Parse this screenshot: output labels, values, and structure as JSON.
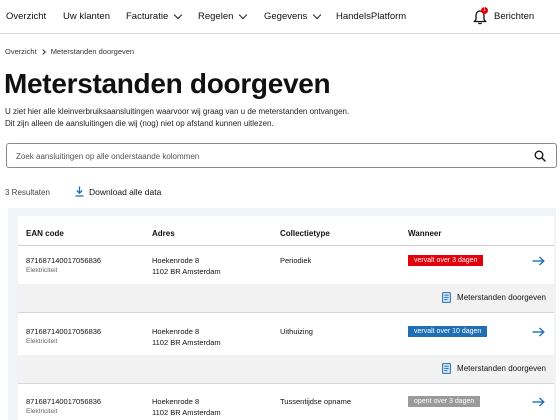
{
  "nav": {
    "items": [
      {
        "label": "Overzicht",
        "dropdown": false
      },
      {
        "label": "Uw klanten",
        "dropdown": false
      },
      {
        "label": "Facturatie",
        "dropdown": true
      },
      {
        "label": "Regelen",
        "dropdown": true
      },
      {
        "label": "Gegevens",
        "dropdown": true
      },
      {
        "label": "HandelsPlatform",
        "dropdown": false
      }
    ],
    "notifications_count": "1",
    "messages_label": "Berichten"
  },
  "breadcrumb": {
    "items": [
      "Overzicht",
      "Meterstanden doorgeven"
    ]
  },
  "page": {
    "title": "Meterstanden doorgeven",
    "intro_line1": "U ziet hier alle kleinverbruiksaansluitingen waarvoor wij graag van u de meterstanden ontvangen.",
    "intro_line2": "Dit zijn alleen de aansluitingen die wij (nog) niet op afstand kunnen uitlezen."
  },
  "search": {
    "placeholder": "Zoek aansluitingen op alle onderstaande kolommen",
    "value": ""
  },
  "toolbar": {
    "results_label": "3 Resultaten",
    "download_label": "Download alle data"
  },
  "table": {
    "columns": [
      "EAN code",
      "Adres",
      "Collectietype",
      "Wanneer"
    ],
    "rows": [
      {
        "ean": "871687140017056836",
        "type": "Elektriciteit",
        "address_line1": "Hoekenrode 8",
        "address_line2": "1102 BR Amsterdam",
        "collection": "Periodiek",
        "status": "vervalt over 3 dagen",
        "status_color": "#e3000b",
        "action_label": "Meterstanden doorgeven"
      },
      {
        "ean": "871687140017056836",
        "type": "Elektriciteit",
        "address_line1": "Hoekenrode 8",
        "address_line2": "1102 BR Amsterdam",
        "collection": "Uithuizing",
        "status": "vervalt over 10 dagen",
        "status_color": "#1f6fb5",
        "action_label": "Meterstanden doorgeven"
      },
      {
        "ean": "871687140017056836",
        "type": "Elektriciteit",
        "address_line1": "Hoekenrode 8",
        "address_line2": "1102 BR Amsterdam",
        "collection": "Tussentijdse opname",
        "status": "opent over 3 dagen",
        "status_color": "#9a9a9a"
      }
    ]
  },
  "icons": {
    "dropdown": "chevron-down-icon",
    "notifications": "bell-icon",
    "breadcrumb_separator": "chevron-right-icon",
    "search": "search-icon",
    "download": "download-icon",
    "row_open": "arrow-right-icon",
    "action": "document-icon"
  },
  "colors": {
    "accent_blue": "#1f6fb5",
    "alert_red": "#e3000b",
    "neutral_gray": "#9a9a9a",
    "table_background": "#eef4f8"
  }
}
